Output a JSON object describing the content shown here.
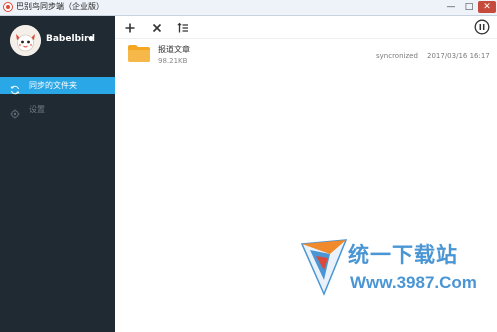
{
  "window": {
    "title": "巴别鸟同步端（企业版）",
    "minimize_glyph": "—",
    "maximize_glyph": "□",
    "close_glyph": "✕"
  },
  "sidebar": {
    "username": "Babelbird",
    "items": [
      {
        "label": "同步的文件夹",
        "icon": "sync-icon",
        "active": true
      },
      {
        "label": "设置",
        "icon": "gear-icon",
        "active": false
      }
    ]
  },
  "toolbar": {
    "buttons": [
      "add-icon",
      "remove-icon",
      "sort-icon",
      "pause-icon"
    ]
  },
  "files": [
    {
      "name": "报道文章",
      "size": "98.21KB",
      "status": "syncronized",
      "date": "2017/03/16 16:17",
      "icon": "folder-icon"
    }
  ],
  "watermark": {
    "text_cn": "统一下载站",
    "url": "Www.3987.Com"
  },
  "colors": {
    "sidebar_bg": "#1f2a33",
    "accent": "#2aa7e6",
    "folder": "#f5a623",
    "watermark": "#4a95d4"
  }
}
